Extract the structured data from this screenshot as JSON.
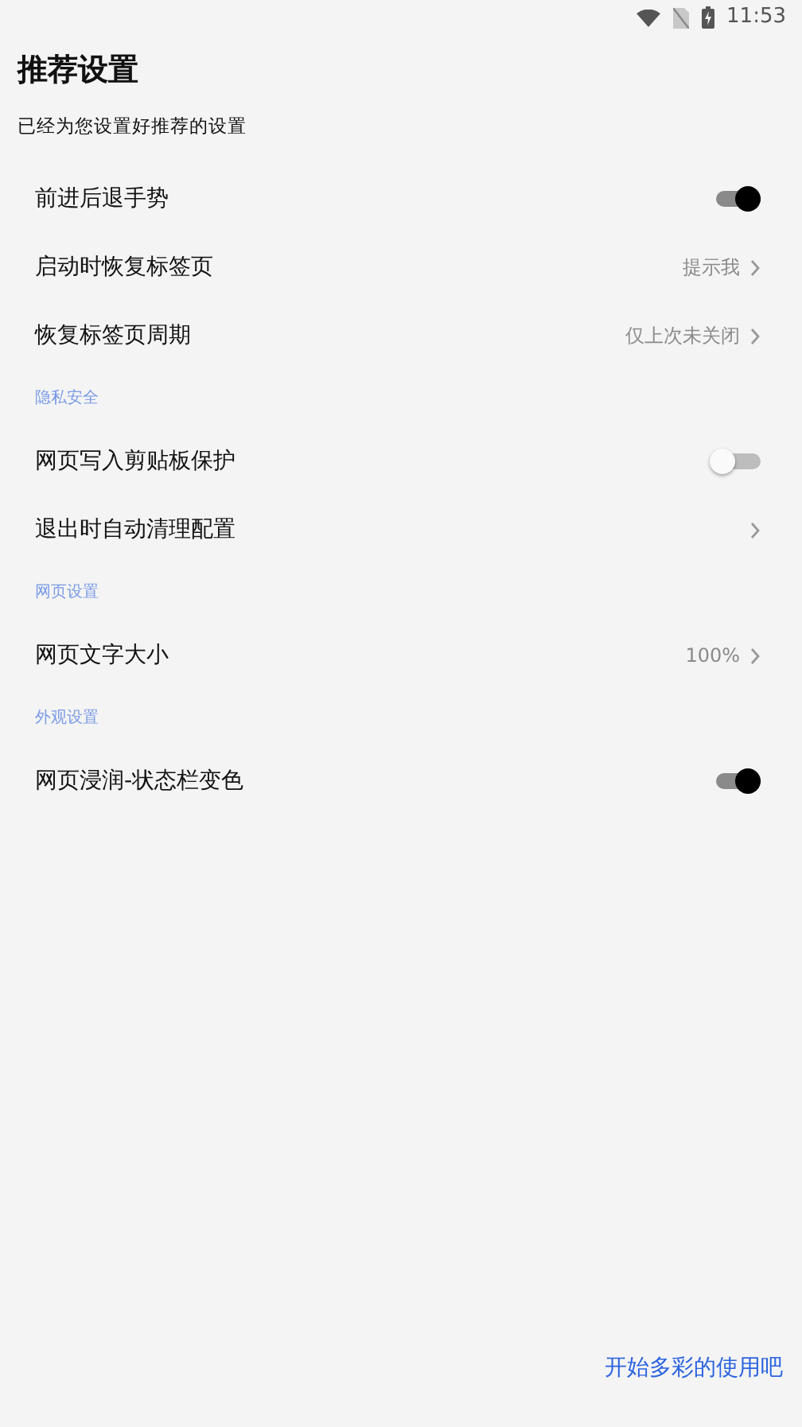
{
  "status_bar": {
    "time": "11:53"
  },
  "title": "推荐设置",
  "subtitle": "已经为您设置好推荐的设置",
  "items": [
    {
      "kind": "toggle",
      "label": "前进后退手势",
      "on": true
    },
    {
      "kind": "link",
      "label": "启动时恢复标签页",
      "value": "提示我"
    },
    {
      "kind": "link",
      "label": "恢复标签页周期",
      "value": "仅上次未关闭"
    },
    {
      "kind": "section",
      "label": "隐私安全"
    },
    {
      "kind": "toggle",
      "label": "网页写入剪贴板保护",
      "on": false
    },
    {
      "kind": "link",
      "label": "退出时自动清理配置"
    },
    {
      "kind": "section",
      "label": "网页设置"
    },
    {
      "kind": "link",
      "label": "网页文字大小",
      "value": "100%"
    },
    {
      "kind": "section",
      "label": "外观设置"
    },
    {
      "kind": "toggle",
      "label": "网页浸润-状态栏变色",
      "on": true
    }
  ],
  "footer_link": "开始多彩的使用吧"
}
